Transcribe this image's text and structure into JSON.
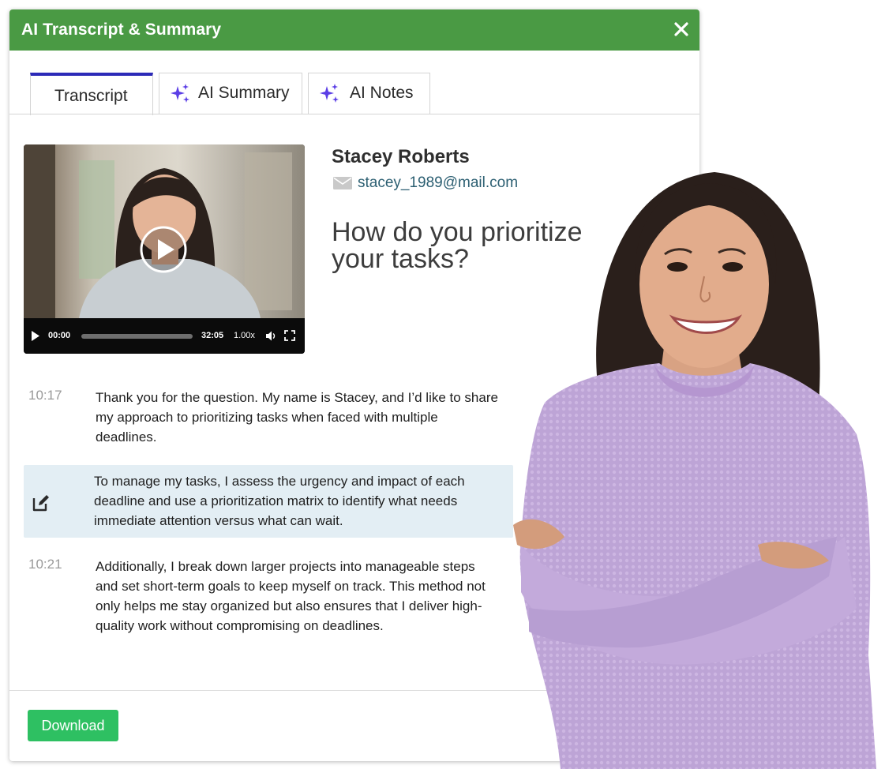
{
  "window": {
    "title": "AI Transcript & Summary"
  },
  "tabs": [
    {
      "label": "Transcript"
    },
    {
      "label": "AI Summary",
      "icon": "sparkle-icon"
    },
    {
      "label": "AI Notes",
      "icon": "sparkle-icon"
    }
  ],
  "video": {
    "current_time": "00:00",
    "duration": "32:05",
    "speed": "1.00x"
  },
  "candidate": {
    "name": "Stacey Roberts",
    "email": "stacey_1989@mail.com"
  },
  "question": "How do you prioritize your tasks?",
  "transcript": [
    {
      "time": "10:17",
      "text": "Thank you for the question. My name is Stacey, and I’d like to share my approach to prioritizing tasks when faced with multiple deadlines."
    },
    {
      "time": "",
      "text": "To manage my tasks, I assess the urgency and impact of each deadline and use a prioritization matrix to identify what needs immediate attention versus what can wait."
    },
    {
      "time": "10:21",
      "text": "Additionally, I break down larger projects into manageable steps and set short-term goals to keep myself on track. This method not only helps me stay organized but also ensures that I deliver high-quality work without compromising on deadlines."
    }
  ],
  "actions": {
    "download_label": "Download"
  },
  "colors": {
    "header_green": "#4a9a44",
    "tab_accent": "#2c2ab8",
    "sparkle_purple": "#5b3ee6",
    "download_green": "#2ec062",
    "highlight_row": "#e3eef4",
    "email_link": "#2c5f72"
  }
}
